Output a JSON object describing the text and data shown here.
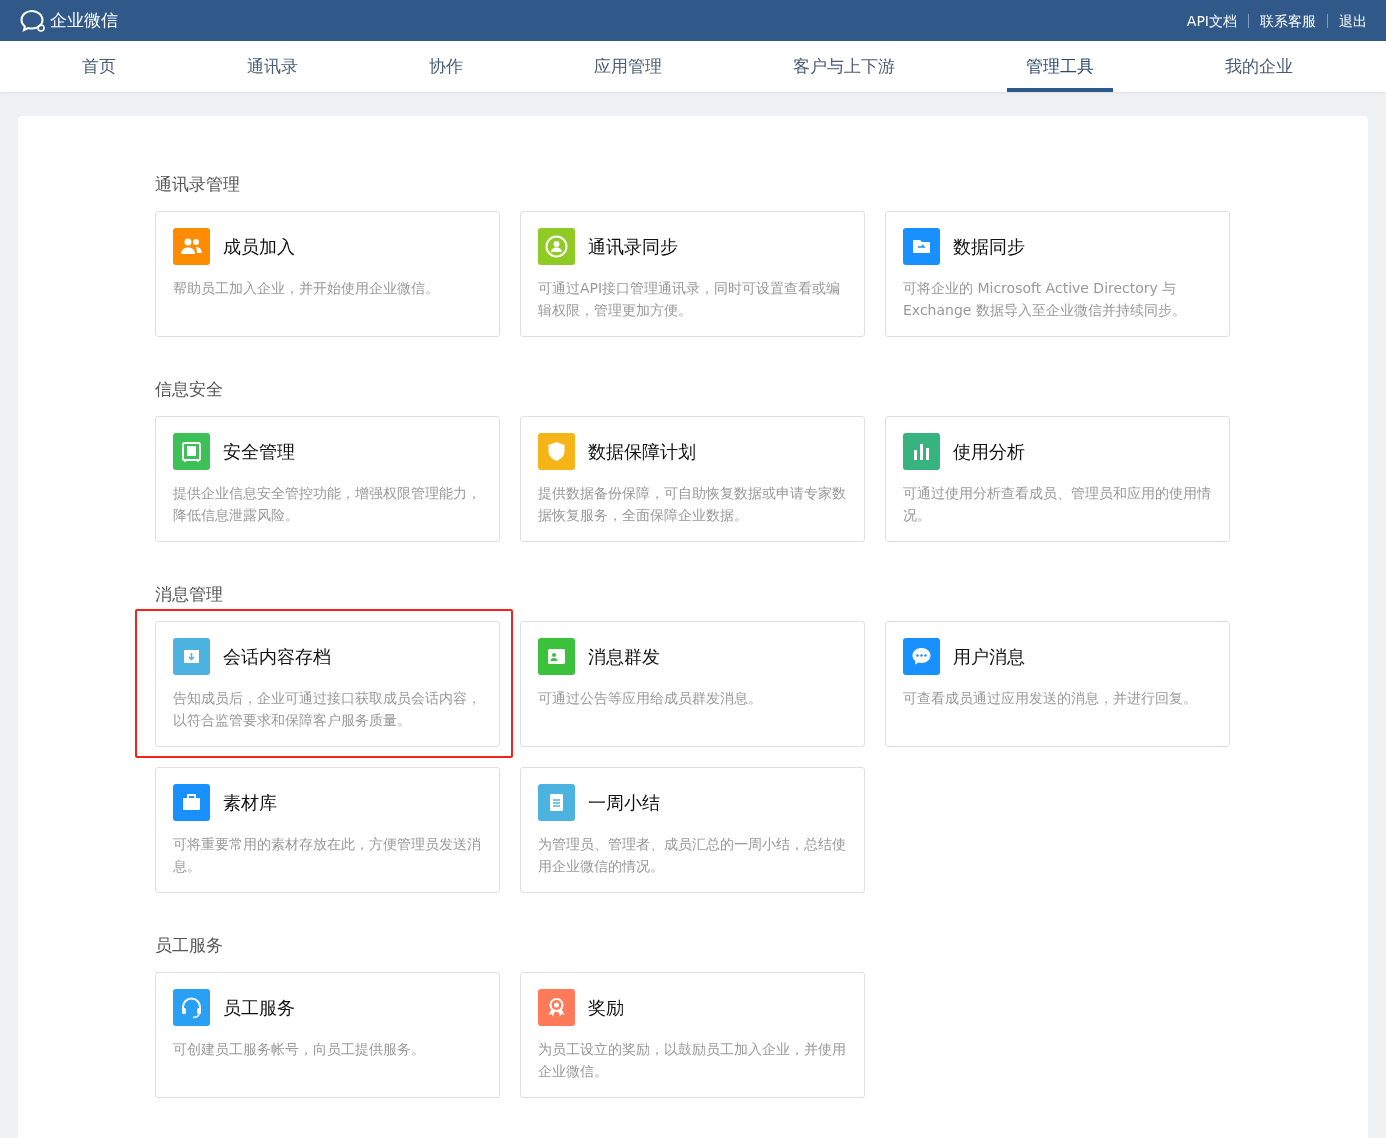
{
  "header": {
    "logo_text": "企业微信",
    "links": [
      "API文档",
      "联系客服",
      "退出"
    ]
  },
  "nav": [
    {
      "label": "首页",
      "selected": false
    },
    {
      "label": "通讯录",
      "selected": false
    },
    {
      "label": "协作",
      "selected": false
    },
    {
      "label": "应用管理",
      "selected": false
    },
    {
      "label": "客户与上下游",
      "selected": false
    },
    {
      "label": "管理工具",
      "selected": true
    },
    {
      "label": "我的企业",
      "selected": false
    }
  ],
  "sections": [
    {
      "title": "通讯录管理",
      "cards": [
        {
          "kind": "users",
          "color": "#ff8c00",
          "title": "成员加入",
          "desc": "帮助员工加入企业，并开始使用企业微信。",
          "highlighted": false
        },
        {
          "kind": "sync",
          "color": "#8fcb23",
          "title": "通讯录同步",
          "desc": "可通过API接口管理通讯录，同时可设置查看或编辑权限，管理更加方便。",
          "highlighted": false
        },
        {
          "kind": "folder",
          "color": "#1890ff",
          "title": "数据同步",
          "desc": "可将企业的 Microsoft Active Directory 与 Exchange 数据导入至企业微信并持续同步。",
          "highlighted": false
        }
      ]
    },
    {
      "title": "信息安全",
      "cards": [
        {
          "kind": "safe",
          "color": "#3cc156",
          "title": "安全管理",
          "desc": "提供企业信息安全管控功能，增强权限管理能力，降低信息泄露风险。",
          "highlighted": false
        },
        {
          "kind": "shield",
          "color": "#f5b418",
          "title": "数据保障计划",
          "desc": "提供数据备份保障，可自助恢复数据或申请专家数据恢复服务，全面保障企业数据。",
          "highlighted": false
        },
        {
          "kind": "chart",
          "color": "#36b37e",
          "title": "使用分析",
          "desc": "可通过使用分析查看成员、管理员和应用的使用情况。",
          "highlighted": false
        }
      ]
    },
    {
      "title": "消息管理",
      "cards": [
        {
          "kind": "archive",
          "color": "#4cb2e0",
          "title": "会话内容存档",
          "desc": "告知成员后，企业可通过接口获取成员会话内容，以符合监管要求和保障客户服务质量。",
          "highlighted": true
        },
        {
          "kind": "megaphone",
          "color": "#3cc13c",
          "title": "消息群发",
          "desc": "可通过公告等应用给成员群发消息。",
          "highlighted": false
        },
        {
          "kind": "chat",
          "color": "#1890ff",
          "title": "用户消息",
          "desc": "可查看成员通过应用发送的消息，并进行回复。",
          "highlighted": false
        },
        {
          "kind": "briefcase",
          "color": "#1890ff",
          "title": "素材库",
          "desc": "可将重要常用的素材存放在此，方便管理员发送消息。",
          "highlighted": false
        },
        {
          "kind": "clipboard",
          "color": "#4cb2e0",
          "title": "一周小结",
          "desc": "为管理员、管理者、成员汇总的一周小结，总结使用企业微信的情况。",
          "highlighted": false
        }
      ]
    },
    {
      "title": "员工服务",
      "cards": [
        {
          "kind": "headset",
          "color": "#2aa0f5",
          "title": "员工服务",
          "desc": "可创建员工服务帐号，向员工提供服务。",
          "highlighted": false
        },
        {
          "kind": "award",
          "color": "#ff7a59",
          "title": "奖励",
          "desc": "为员工设立的奖励，以鼓励员工加入企业，并使用企业微信。",
          "highlighted": false
        }
      ]
    }
  ]
}
